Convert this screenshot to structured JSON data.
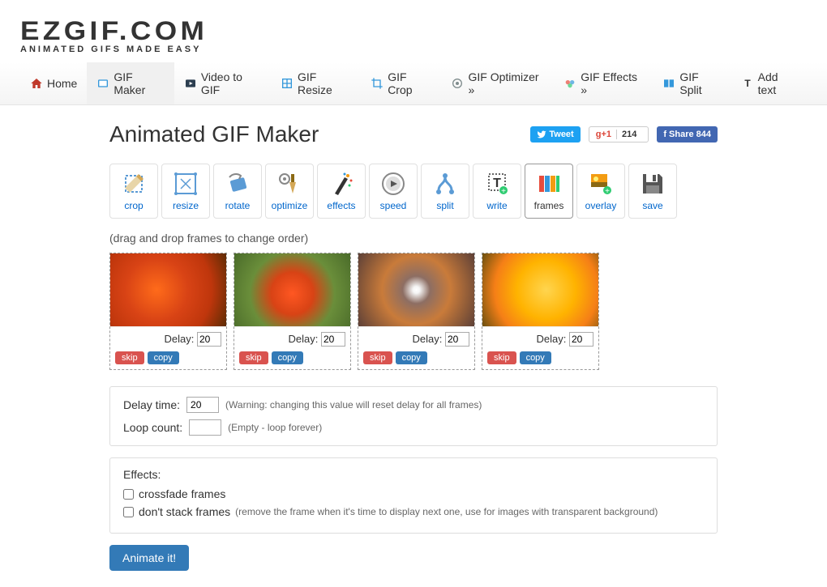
{
  "logo": {
    "main": "EZGIF.COM",
    "sub": "ANIMATED GIFS MADE EASY"
  },
  "nav": [
    {
      "label": "Home",
      "icon": "home"
    },
    {
      "label": "GIF Maker",
      "icon": "gif",
      "active": true
    },
    {
      "label": "Video to GIF",
      "icon": "video"
    },
    {
      "label": "GIF Resize",
      "icon": "resize"
    },
    {
      "label": "GIF Crop",
      "icon": "crop"
    },
    {
      "label": "GIF Optimizer »",
      "icon": "optimize"
    },
    {
      "label": "GIF Effects »",
      "icon": "effects"
    },
    {
      "label": "GIF Split",
      "icon": "split"
    },
    {
      "label": "Add text",
      "icon": "text"
    }
  ],
  "title": "Animated GIF Maker",
  "share": {
    "tweet": "Tweet",
    "gplus_label": "g+1",
    "gplus_count": "214",
    "fb": "Share 844"
  },
  "tools": [
    {
      "label": "crop"
    },
    {
      "label": "resize"
    },
    {
      "label": "rotate"
    },
    {
      "label": "optimize"
    },
    {
      "label": "effects"
    },
    {
      "label": "speed"
    },
    {
      "label": "split"
    },
    {
      "label": "write"
    },
    {
      "label": "frames",
      "active": true
    },
    {
      "label": "overlay"
    },
    {
      "label": "save"
    }
  ],
  "hint": "(drag and drop frames to change order)",
  "frames": [
    {
      "delay_label": "Delay:",
      "delay_value": "20",
      "skip": "skip",
      "copy": "copy"
    },
    {
      "delay_label": "Delay:",
      "delay_value": "20",
      "skip": "skip",
      "copy": "copy"
    },
    {
      "delay_label": "Delay:",
      "delay_value": "20",
      "skip": "skip",
      "copy": "copy"
    },
    {
      "delay_label": "Delay:",
      "delay_value": "20",
      "skip": "skip",
      "copy": "copy"
    }
  ],
  "settings": {
    "delay_label": "Delay time:",
    "delay_value": "20",
    "delay_note": "(Warning: changing this value will reset delay for all frames)",
    "loop_label": "Loop count:",
    "loop_value": "",
    "loop_note": "(Empty - loop forever)"
  },
  "effects": {
    "title": "Effects:",
    "crossfade": "crossfade frames",
    "dontstack": "don't stack frames",
    "dontstack_note": "(remove the frame when it's time to display next one, use for images with transparent background)"
  },
  "animate_btn": "Animate it!"
}
